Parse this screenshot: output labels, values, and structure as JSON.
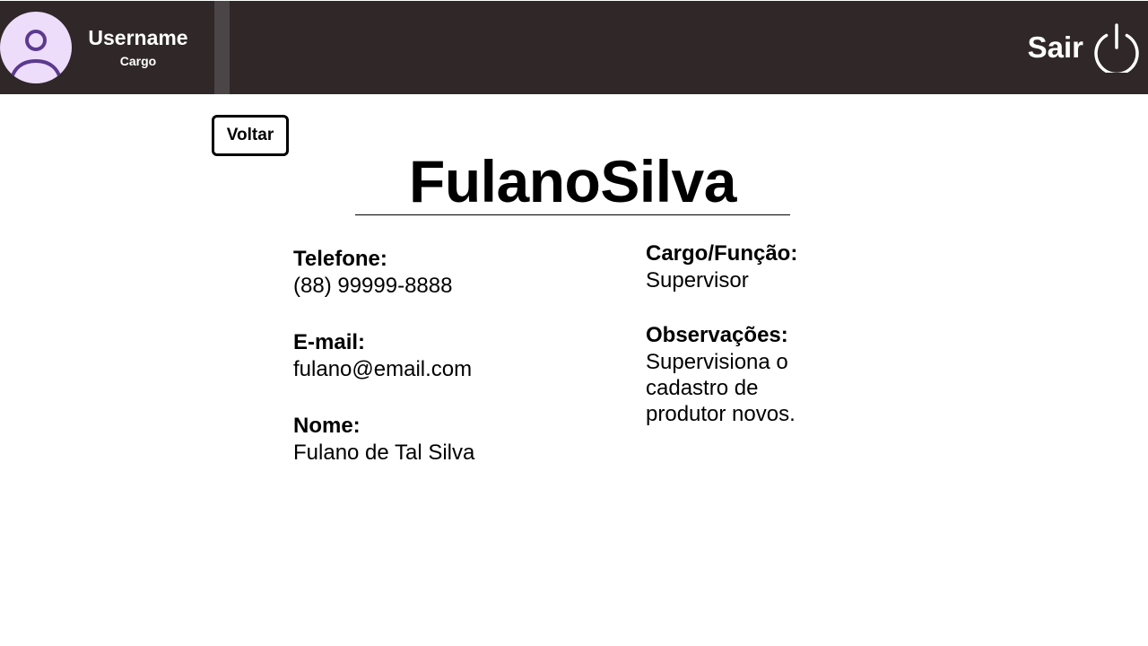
{
  "header": {
    "username": "Username",
    "role": "Cargo",
    "logout_label": "Sair",
    "background_color": "#2f2728",
    "avatar_color": "#eedcfb",
    "avatar_icon_color": "#5b3a8e",
    "avatar_icon": "user-icon",
    "logout_icon": "power-icon"
  },
  "actions": {
    "back_label": "Voltar"
  },
  "profile": {
    "title": "FulanoSilva",
    "phone": {
      "label": "Telefone:",
      "value": "(88) 99999-8888"
    },
    "email": {
      "label": "E-mail:",
      "value": "fulano@email.com"
    },
    "name": {
      "label": "Nome:",
      "value": "Fulano de Tal Silva"
    },
    "role": {
      "label": "Cargo/Função:",
      "value": "Supervisor"
    },
    "notes": {
      "label": "Observações:",
      "value": "Supervisiona o cadastro de produtor novos."
    }
  }
}
